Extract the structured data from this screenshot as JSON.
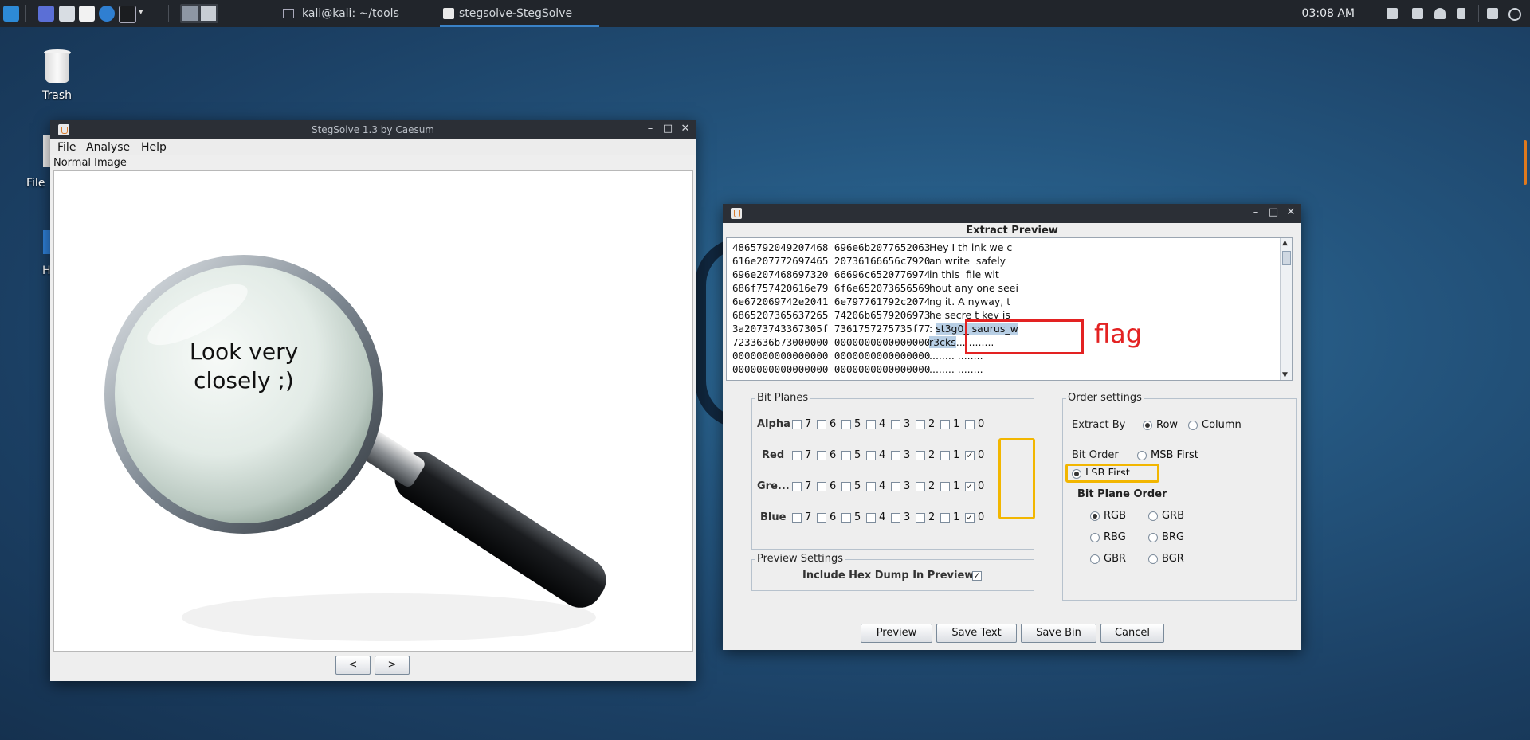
{
  "taskbar": {
    "tasks": [
      {
        "label": "kali@kali: ~/tools",
        "active": false
      },
      {
        "label": "stegsolve-StegSolve",
        "active": true
      }
    ],
    "clock": "03:08 AM",
    "icons": [
      "kali-menu-icon",
      "desktop-icon",
      "file-manager-icon",
      "text-editor-icon",
      "browser-icon",
      "terminal-icon",
      "chevron-down-icon"
    ]
  },
  "desktop": {
    "trash_label": "Trash",
    "file_label": "File",
    "home_label": "H"
  },
  "image_window": {
    "title": "StegSolve 1.3 by Caesum",
    "menu": [
      "File",
      "Analyse",
      "Help"
    ],
    "mode_label": "Normal Image",
    "image_text_line1": "Look very",
    "image_text_line2": "closely ;)",
    "prev_label": "<",
    "next_label": ">"
  },
  "extract_window": {
    "heading": "Extract Preview",
    "hex_lines": [
      {
        "hex": "4865792049207468 696e6b2077652063",
        "ascii": "Hey I th ink we c"
      },
      {
        "hex": "616e207772697465 20736166656c7920",
        "ascii": "an write  safely "
      },
      {
        "hex": "696e207468697320 66696c6520776974",
        "ascii": "in this  file wit"
      },
      {
        "hex": "686f757420616e79 6f6e652073656569",
        "ascii": "hout any one seei"
      },
      {
        "hex": "6e672069742e2041 6e797761792c2074",
        "ascii": "ng it. A nyway, t"
      },
      {
        "hex": "6865207365637265 74206b6579206973",
        "ascii": "he secre t key is"
      },
      {
        "hex": "3a2073743367305f 7361757275735f77",
        "ascii_pre": ": ",
        "ascii_hl": "st3g0_ saurus_w",
        "ascii": ""
      },
      {
        "hex": "7233636b73000000 0000000000000000",
        "ascii_hl": "r3cks",
        "ascii": "... ........"
      },
      {
        "hex": "0000000000000000 0000000000000000",
        "ascii": "........ ........"
      },
      {
        "hex": "0000000000000000 0000000000000000",
        "ascii": "........ ........"
      }
    ],
    "flag_annotation": "flag",
    "bit_planes": {
      "title": "Bit Planes",
      "rows": [
        {
          "label": "Alpha",
          "checked": []
        },
        {
          "label": "Red",
          "checked": [
            "0"
          ]
        },
        {
          "label": "Gre...",
          "checked": [
            "0"
          ]
        },
        {
          "label": "Blue",
          "checked": [
            "0"
          ]
        }
      ],
      "bits": [
        "7",
        "6",
        "5",
        "4",
        "3",
        "2",
        "1",
        "0"
      ]
    },
    "preview_settings": {
      "title": "Preview Settings",
      "hex_dump_label": "Include Hex Dump In Preview",
      "hex_dump_checked": true
    },
    "order_settings": {
      "title": "Order settings",
      "extract_by_label": "Extract By",
      "row_label": "Row",
      "column_label": "Column",
      "extract_by_value": "Row",
      "bit_order_label": "Bit Order",
      "msb_label": "MSB First",
      "lsb_label": "LSB First",
      "bit_plane_order_label": "Bit Plane Order",
      "plane_orders": [
        "RGB",
        "GRB",
        "RBG",
        "BRG",
        "GBR",
        "BGR"
      ],
      "plane_order_value": "RGB"
    },
    "buttons": {
      "preview": "Preview",
      "save_text": "Save Text",
      "save_bin": "Save Bin",
      "cancel": "Cancel"
    },
    "accent_colors": {
      "annotation_red": "#e32222",
      "annotation_yellow": "#f2b600",
      "selection": "#b8cfe5"
    }
  }
}
